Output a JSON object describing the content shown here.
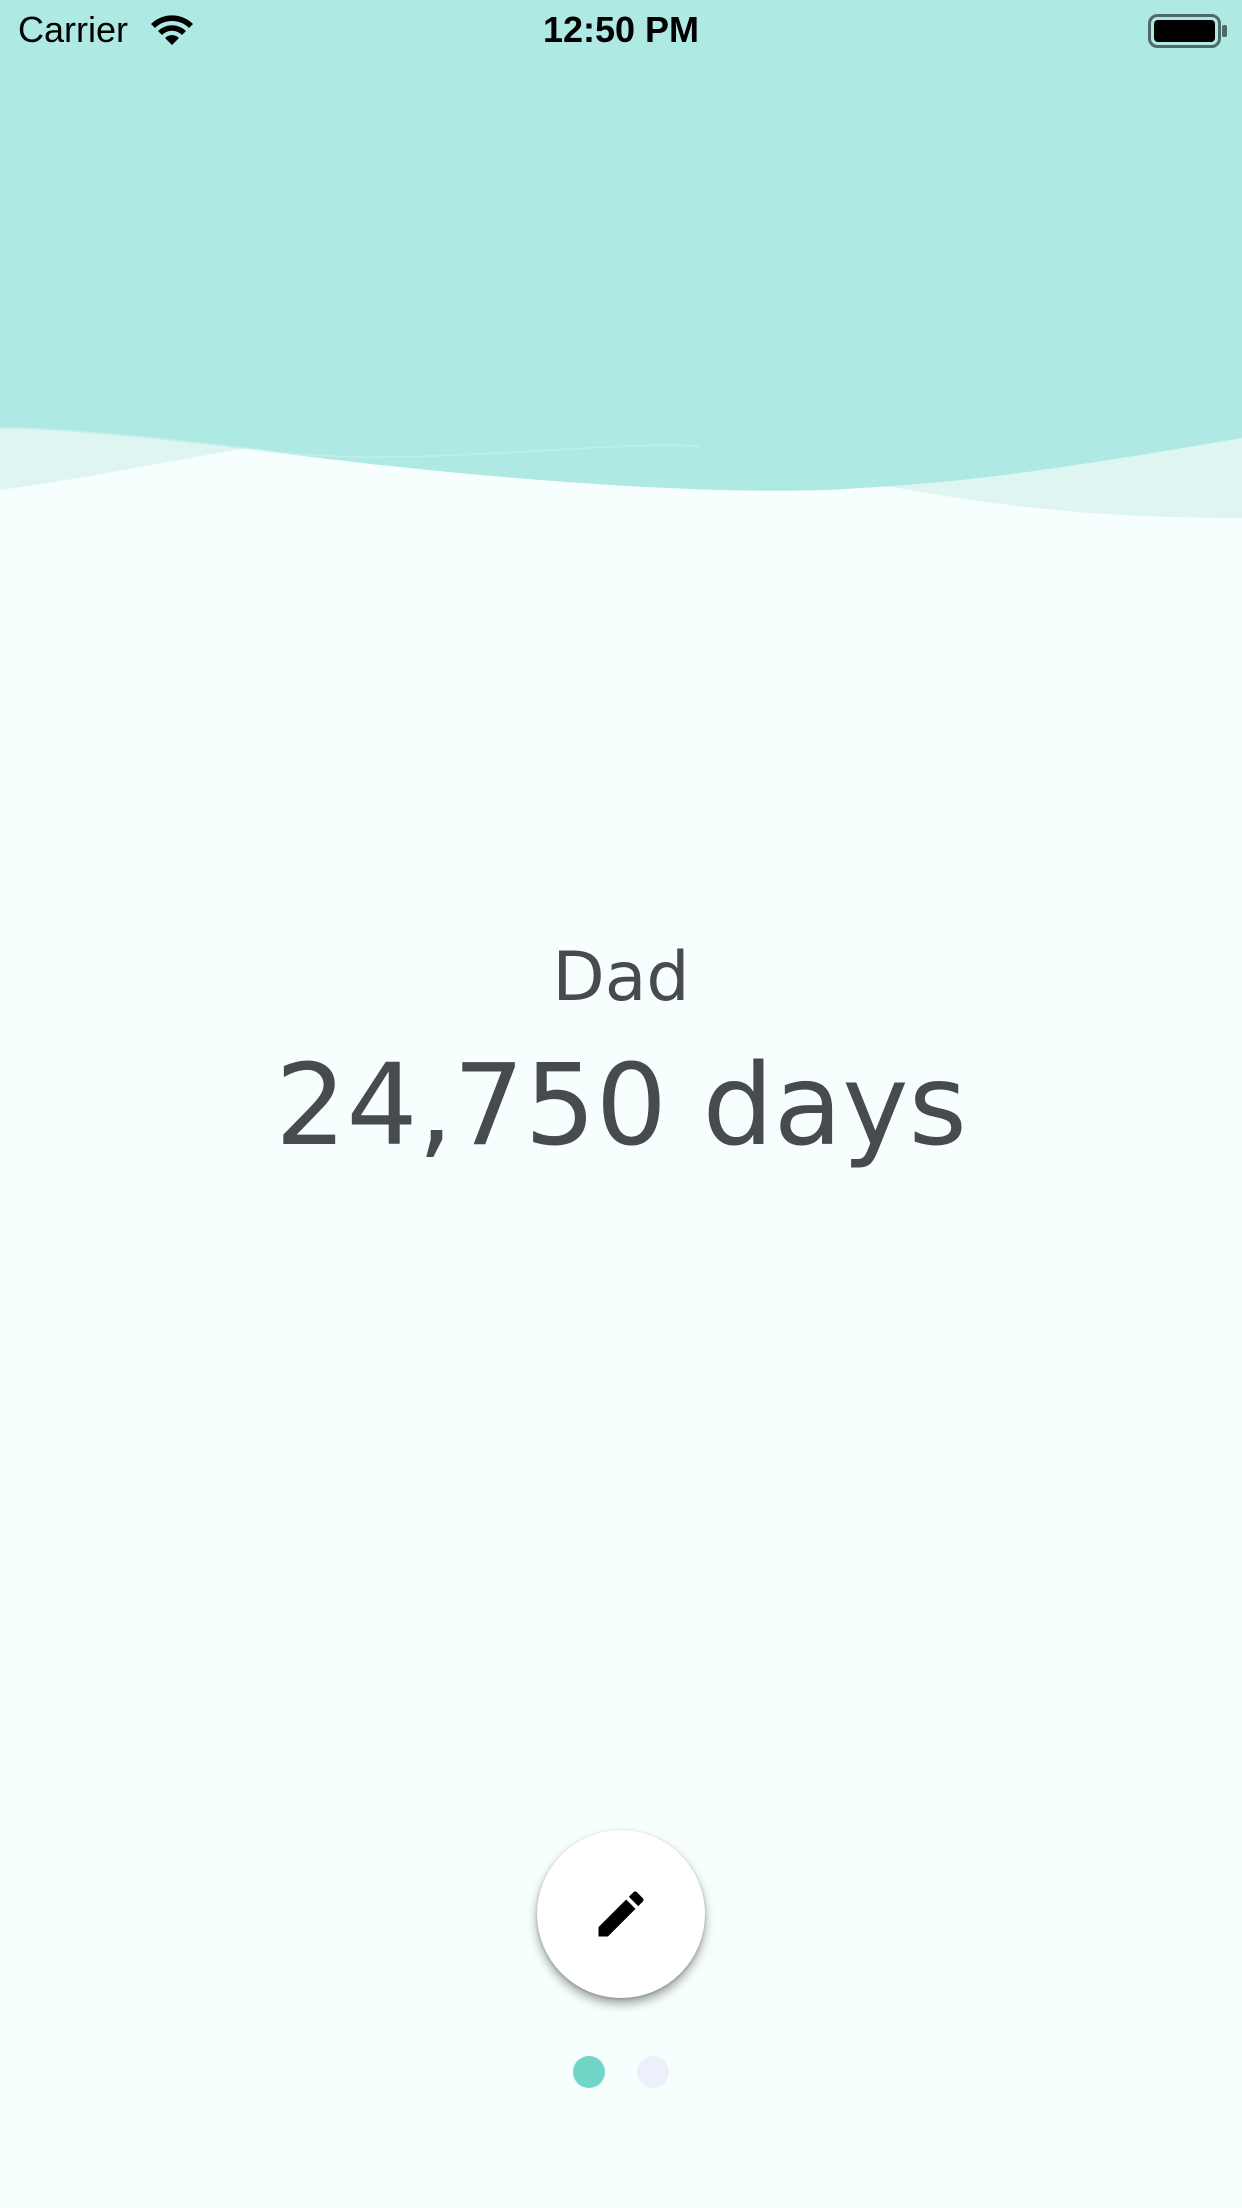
{
  "status_bar": {
    "carrier": "Carrier",
    "time": "12:50 PM"
  },
  "counter": {
    "name": "Dad",
    "days": "24,750 days"
  },
  "page_indicator": {
    "total": 2,
    "current": 1
  },
  "colors": {
    "header": "#aeeae3",
    "background": "#f6fefe",
    "text": "#474b4e",
    "dot_active": "#70d6c7",
    "dot_inactive": "#ecf0fa"
  },
  "icons": {
    "edit": "pencil-icon",
    "wifi": "wifi-icon",
    "battery": "battery-icon"
  }
}
